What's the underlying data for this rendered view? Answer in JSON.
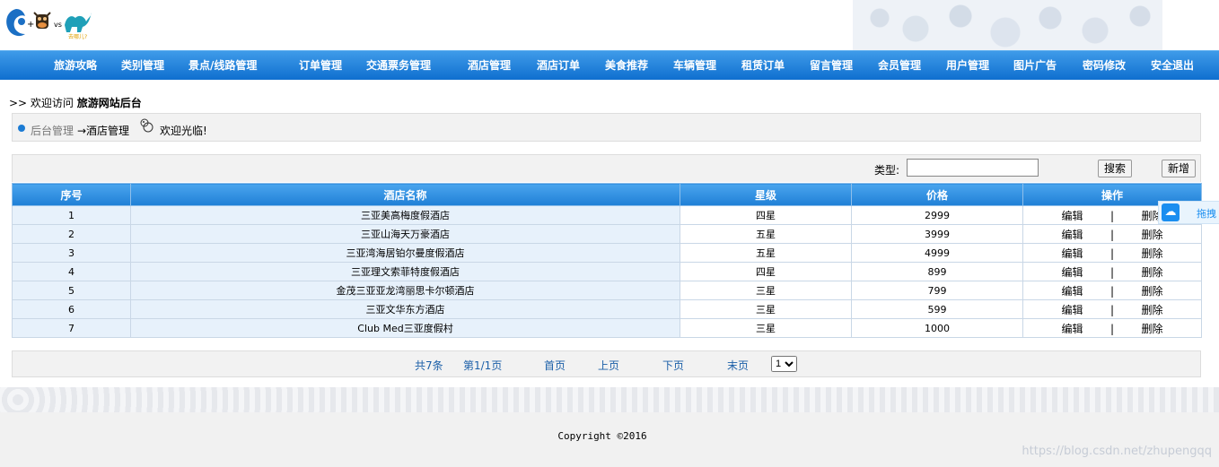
{
  "logo": {
    "vs_text": "vs",
    "plus_text": "+",
    "brand_text": "去哪儿?"
  },
  "nav": [
    "旅游攻略",
    "类别管理",
    "景点/线路管理",
    "订单管理",
    "交通票务管理",
    "酒店管理",
    "酒店订单",
    "美食推荐",
    "车辆管理",
    "租赁订单",
    "留言管理",
    "会员管理",
    "用户管理",
    "图片广告",
    "密码修改",
    "安全退出"
  ],
  "welcome": {
    "prefix": ">> 欢迎访问",
    "site": "旅游网站后台"
  },
  "breadcrumb": {
    "home": "后台管理",
    "current": "→酒店管理",
    "greeting": "欢迎光临!"
  },
  "search": {
    "label": "类型:",
    "value": "",
    "search_button": "搜索",
    "add_button": "新增"
  },
  "table": {
    "headers": [
      "序号",
      "酒店名称",
      "星级",
      "价格",
      "操作"
    ],
    "rows": [
      {
        "id": "1",
        "name": "三亚美高梅度假酒店",
        "star": "四星",
        "price": "2999"
      },
      {
        "id": "2",
        "name": "三亚山海天万豪酒店",
        "star": "五星",
        "price": "3999"
      },
      {
        "id": "3",
        "name": "三亚湾海居铂尔曼度假酒店",
        "star": "五星",
        "price": "4999"
      },
      {
        "id": "4",
        "name": "三亚理文索菲特度假酒店",
        "star": "四星",
        "price": "899"
      },
      {
        "id": "5",
        "name": "金茂三亚亚龙湾丽思卡尔顿酒店",
        "star": "三星",
        "price": "799"
      },
      {
        "id": "6",
        "name": "三亚文华东方酒店",
        "star": "三星",
        "price": "599"
      },
      {
        "id": "7",
        "name": "Club Med三亚度假村",
        "star": "三星",
        "price": "1000"
      }
    ],
    "edit_label": "编辑",
    "sep": "|",
    "delete_label": "删除"
  },
  "pager": {
    "total": "共7条",
    "page": "第1/1页",
    "first": "首页",
    "prev": "上页",
    "next": "下页",
    "last": "末页",
    "select_value": "1"
  },
  "side_tab": {
    "label": "拖拽"
  },
  "footer": {
    "copyright": "Copyright ©2016"
  },
  "watermark": "https://blog.csdn.net/zhupengqq",
  "colors": {
    "nav_top": "#3f9be9",
    "nav_bottom": "#0f6fcf",
    "link": "#1b5fa8"
  }
}
